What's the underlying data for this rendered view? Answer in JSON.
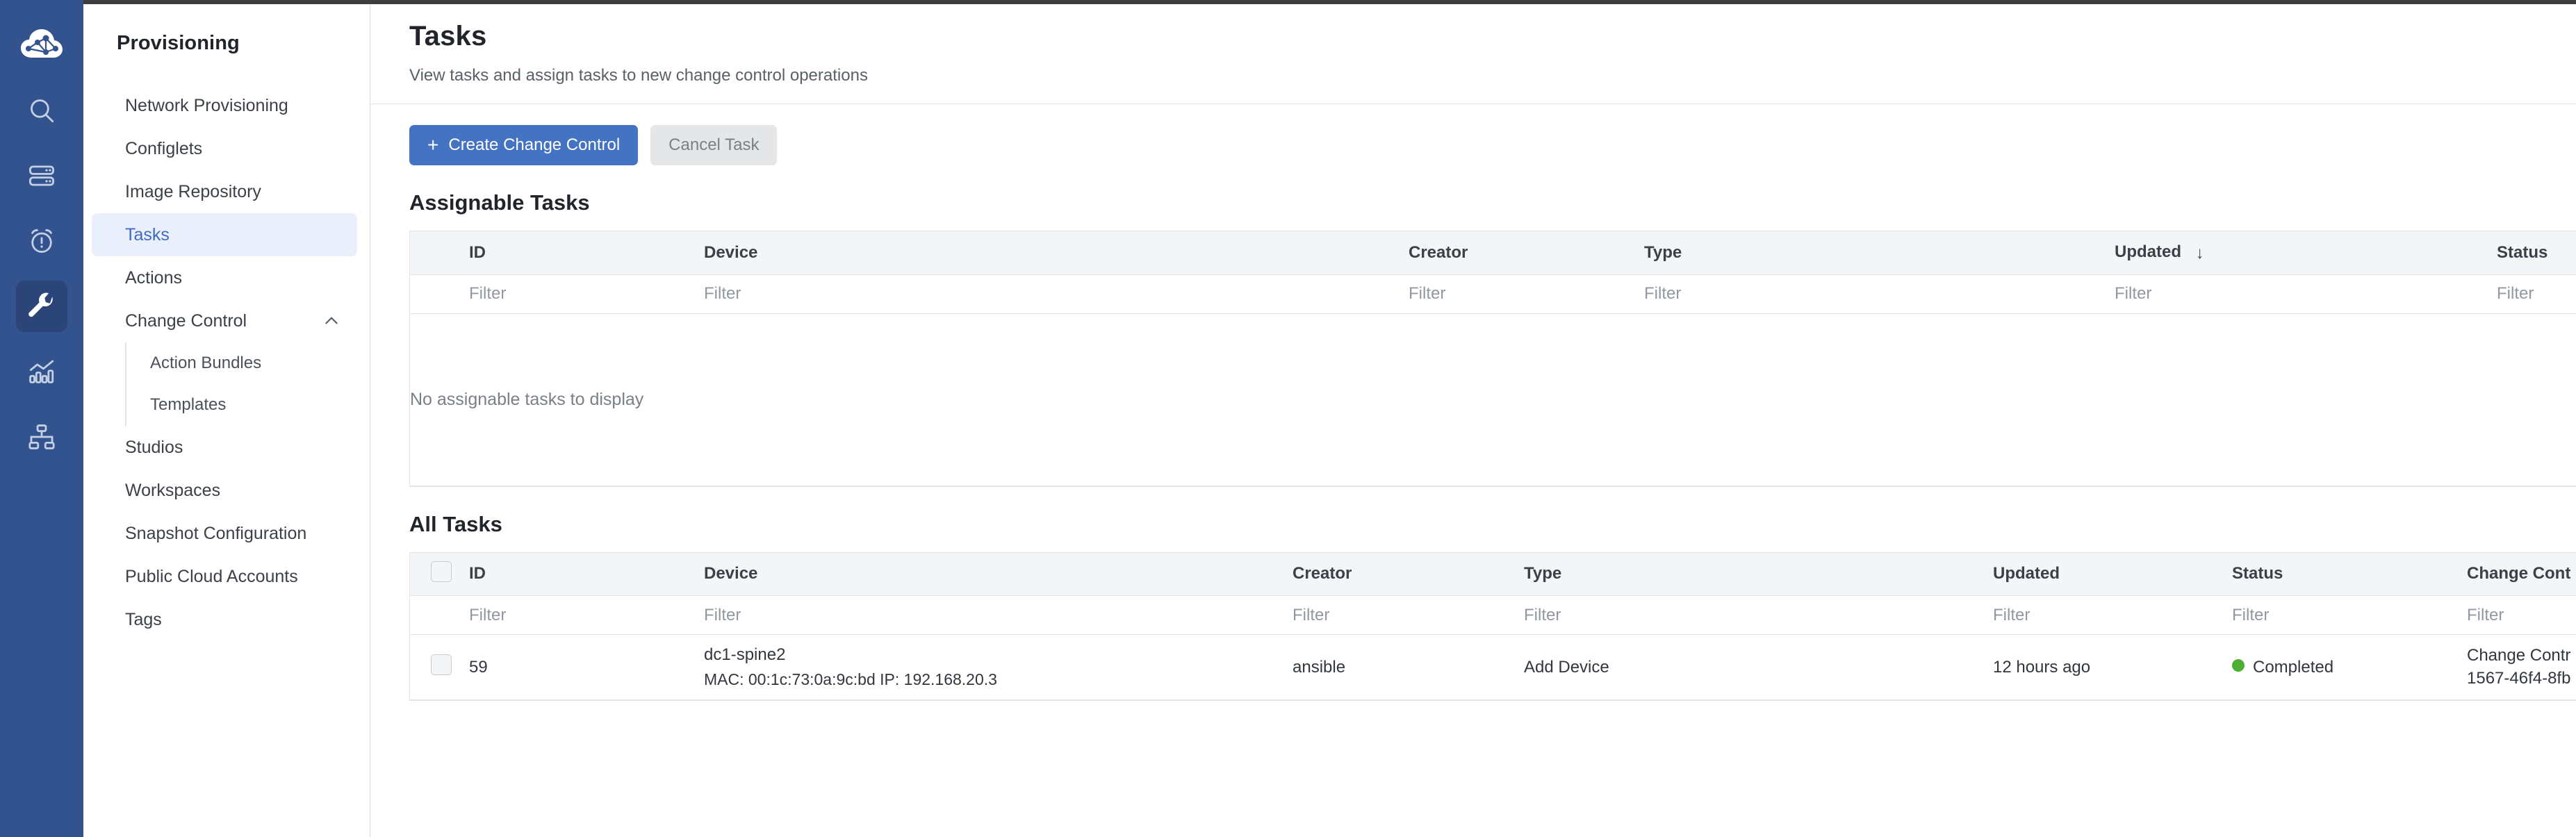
{
  "rail": {
    "logo_icon": "cloud-network-logo",
    "items": [
      {
        "icon": "search-icon",
        "active": false
      },
      {
        "icon": "devices-icon",
        "active": false
      },
      {
        "icon": "alarm-icon",
        "active": false
      },
      {
        "icon": "wrench-icon",
        "active": true
      },
      {
        "icon": "analytics-icon",
        "active": false
      },
      {
        "icon": "topology-icon",
        "active": false
      }
    ]
  },
  "sidebar": {
    "title": "Provisioning",
    "items": [
      {
        "label": "Network Provisioning",
        "active": false,
        "type": "item"
      },
      {
        "label": "Configlets",
        "active": false,
        "type": "item"
      },
      {
        "label": "Image Repository",
        "active": false,
        "type": "item"
      },
      {
        "label": "Tasks",
        "active": true,
        "type": "item"
      },
      {
        "label": "Actions",
        "active": false,
        "type": "item"
      },
      {
        "label": "Change Control",
        "active": false,
        "type": "group",
        "expanded": true,
        "children": [
          {
            "label": "Action Bundles"
          },
          {
            "label": "Templates"
          }
        ]
      },
      {
        "label": "Studios",
        "active": false,
        "type": "item"
      },
      {
        "label": "Workspaces",
        "active": false,
        "type": "item"
      },
      {
        "label": "Snapshot Configuration",
        "active": false,
        "type": "item"
      },
      {
        "label": "Public Cloud Accounts",
        "active": false,
        "type": "item"
      },
      {
        "label": "Tags",
        "active": false,
        "type": "item"
      }
    ],
    "collapse_icon": "chevron-up-icon"
  },
  "page": {
    "title": "Tasks",
    "subtitle": "View tasks and assign tasks to new change control operations"
  },
  "toolbar": {
    "create_label": "Create Change Control",
    "create_plus": "+",
    "cancel_label": "Cancel Task"
  },
  "assignable": {
    "heading": "Assignable Tasks",
    "columns": [
      "ID",
      "Device",
      "Creator",
      "Type",
      "Updated",
      "Status"
    ],
    "sorted_column": "Updated",
    "sort_direction": "desc",
    "sort_glyph": "↓",
    "filters": [
      "Filter",
      "Filter",
      "Filter",
      "Filter",
      "Filter",
      "Filter"
    ],
    "empty_message": "No assignable tasks to display"
  },
  "all_tasks": {
    "heading": "All Tasks",
    "columns": [
      "ID",
      "Device",
      "Creator",
      "Type",
      "Updated",
      "Status",
      "Change Cont"
    ],
    "filters": [
      "Filter",
      "Filter",
      "Filter",
      "Filter",
      "Filter",
      "Filter",
      "Filter"
    ],
    "rows": [
      {
        "id": "59",
        "device_name": "dc1-spine2",
        "device_meta": "MAC: 00:1c:73:0a:9c:bd IP: 192.168.20.3",
        "creator": "ansible",
        "type": "Add Device",
        "updated": "12 hours ago",
        "status": "Completed",
        "status_color": "#4caf32",
        "change_control_line1": "Change Contr",
        "change_control_line2": "1567-46f4-8fb"
      }
    ]
  },
  "colors": {
    "rail_bg": "#33538f",
    "rail_active": "#2b4578",
    "accent": "#4573c4",
    "link": "#3f6bc4",
    "nav_active_bg": "#eaf0fb",
    "header_bg": "#f4f5f7",
    "border": "#e2e5e9",
    "topbar": "#3d3d3d",
    "status_green": "#4caf32"
  }
}
